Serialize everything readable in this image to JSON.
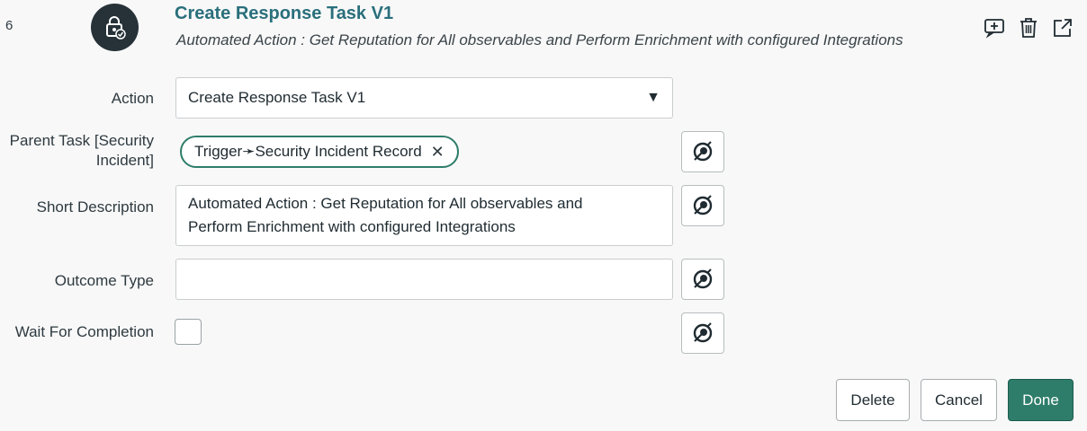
{
  "step": {
    "number": "6",
    "title": "Create Response Task V1",
    "description": "Automated Action : Get Reputation for All observables and Perform Enrichment with configured Integrations"
  },
  "toolbar_icons": [
    "add-comment-icon",
    "trash-icon",
    "open-in-new-icon"
  ],
  "form": {
    "action": {
      "label": "Action",
      "value": "Create Response Task V1"
    },
    "parent_task": {
      "label_line1": "Parent Task [Security",
      "label_line2": "Incident]",
      "pill_part1": "Trigger",
      "pill_part2": "Security Incident Record"
    },
    "short_description": {
      "label": "Short Description",
      "line1": "Automated Action : Get Reputation for All observables and",
      "line2": "Perform Enrichment with configured Integrations"
    },
    "outcome_type": {
      "label": "Outcome Type",
      "value": ""
    },
    "wait_for_completion": {
      "label": "Wait For Completion",
      "checked": false
    }
  },
  "buttons": {
    "delete": "Delete",
    "cancel": "Cancel",
    "done": "Done"
  },
  "colors": {
    "accent": "#2e7d6a",
    "title": "#2a6f7c",
    "icon_bg": "#263238"
  }
}
